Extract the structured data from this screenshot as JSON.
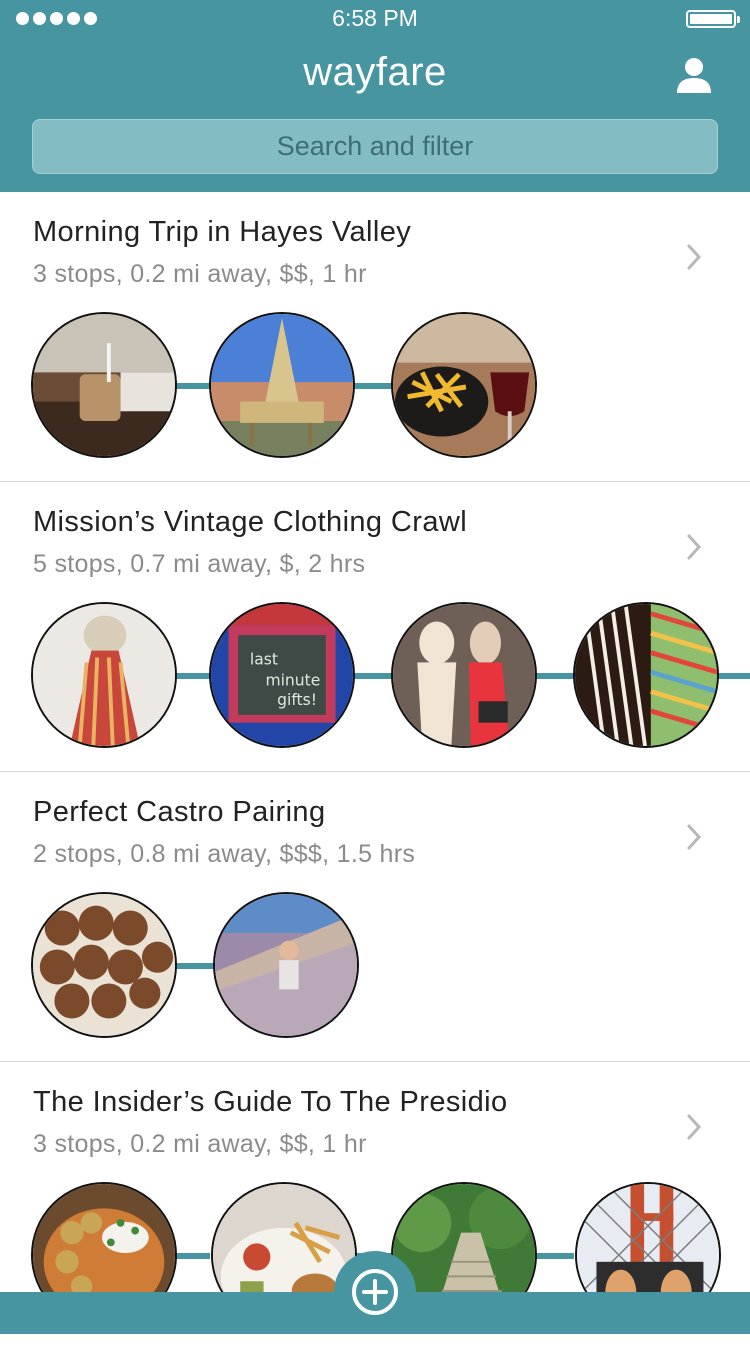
{
  "status_bar": {
    "time": "6:58 PM"
  },
  "header": {
    "title": "wayfare",
    "search_placeholder": "Search and filter"
  },
  "colors": {
    "accent": "#4795a0",
    "search_bg": "#83bcc3"
  },
  "trips": [
    {
      "title": "Morning Trip in Hayes Valley",
      "meta": "3 stops, 0.2 mi away, $$, 1 hr",
      "stops": [
        "coffee-cup-photo",
        "wooden-tower-sculpture-photo",
        "fries-and-wine-photo"
      ]
    },
    {
      "title": "Mission’s Vintage Clothing Crawl",
      "meta": "5 stops, 0.7 mi away, $, 2 hrs",
      "stops": [
        "striped-dress-photo",
        "chalkboard-sign-photo",
        "mannequins-photo",
        "striped-fabrics-photo"
      ]
    },
    {
      "title": "Perfect Castro Pairing",
      "meta": "2 stops, 0.8 mi away, $$$, 1.5 hrs",
      "stops": [
        "falafel-photo",
        "slide-photo"
      ]
    },
    {
      "title": "The Insider’s Guide To The Presidio",
      "meta": "3 stops, 0.2 mi away, $$, 1 hr",
      "stops": [
        "vegetable-dish-photo",
        "plate-with-fries-photo",
        "forest-stairs-photo",
        "golden-gate-fence-photo"
      ]
    }
  ]
}
